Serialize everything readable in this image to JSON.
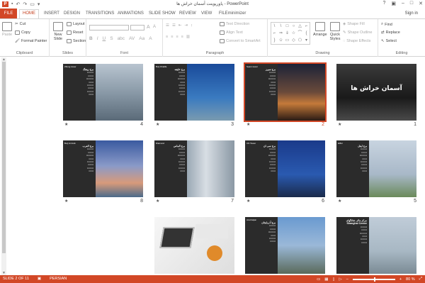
{
  "window": {
    "title": "پاورپوینت آسمان خراش ها - PowerPoint",
    "app_icon": "P"
  },
  "tabs": [
    "FILE",
    "HOME",
    "INSERT",
    "DESIGN",
    "TRANSITIONS",
    "ANIMATIONS",
    "SLIDE SHOW",
    "REVIEW",
    "VIEW",
    "FILEminimizer"
  ],
  "signin": "Sign in",
  "ribbon": {
    "clipboard": {
      "paste": "Paste",
      "cut": "Cut",
      "copy": "Copy",
      "format_painter": "Format Painter",
      "label": "Clipboard"
    },
    "slides": {
      "new_slide": "New Slide",
      "layout": "Layout",
      "reset": "Reset",
      "section": "Section",
      "label": "Slides"
    },
    "font": {
      "label": "Font"
    },
    "paragraph": {
      "text_direction": "Text Direction",
      "align_text": "Align Text",
      "convert": "Convert to SmartArt",
      "label": "Paragraph"
    },
    "drawing": {
      "arrange": "Arrange",
      "quick_styles": "Quick Styles",
      "shape_fill": "Shape Fill",
      "shape_outline": "Shape Outline",
      "shape_effects": "Shape Effects",
      "label": "Drawing"
    },
    "editing": {
      "find": "Find",
      "replace": "Replace",
      "select": "Select",
      "label": "Editing"
    }
  },
  "slides": [
    {
      "num": "1",
      "title": "آسمان خراش ها",
      "type": "cover"
    },
    {
      "num": "2",
      "en": "Sears tower",
      "hd": "برج سیرز",
      "type": "content",
      "selected": true
    },
    {
      "num": "3",
      "en": "Burj Khalifa",
      "hd": "برج خلیفه",
      "type": "content"
    },
    {
      "num": "4",
      "en": "Zifeng tower",
      "hd": "برج زیفنگ",
      "type": "content"
    },
    {
      "num": "5",
      "en": "Eiffel",
      "hd": "برج ایفل",
      "type": "content"
    },
    {
      "num": "6",
      "en": "CN Tower",
      "hd": "برج سی ان",
      "type": "content"
    },
    {
      "num": "7",
      "en": "Diamond",
      "hd": "برج الماس",
      "type": "content"
    },
    {
      "num": "8",
      "en": "Burj Al Arab",
      "hd": "برج العرب",
      "type": "content"
    },
    {
      "num": "9",
      "en": "",
      "hd": "مرکز مالی شانگهای",
      "hd2": "Shanghai Center",
      "type": "content"
    },
    {
      "num": "10",
      "en": "Azerbaijan",
      "hd": "برج آذربایجان",
      "type": "content"
    },
    {
      "num": "11",
      "type": "ad"
    }
  ],
  "status": {
    "slide_info": "SLIDE 2 OF 11",
    "language": "PERSIAN",
    "zoom": "80 %"
  }
}
